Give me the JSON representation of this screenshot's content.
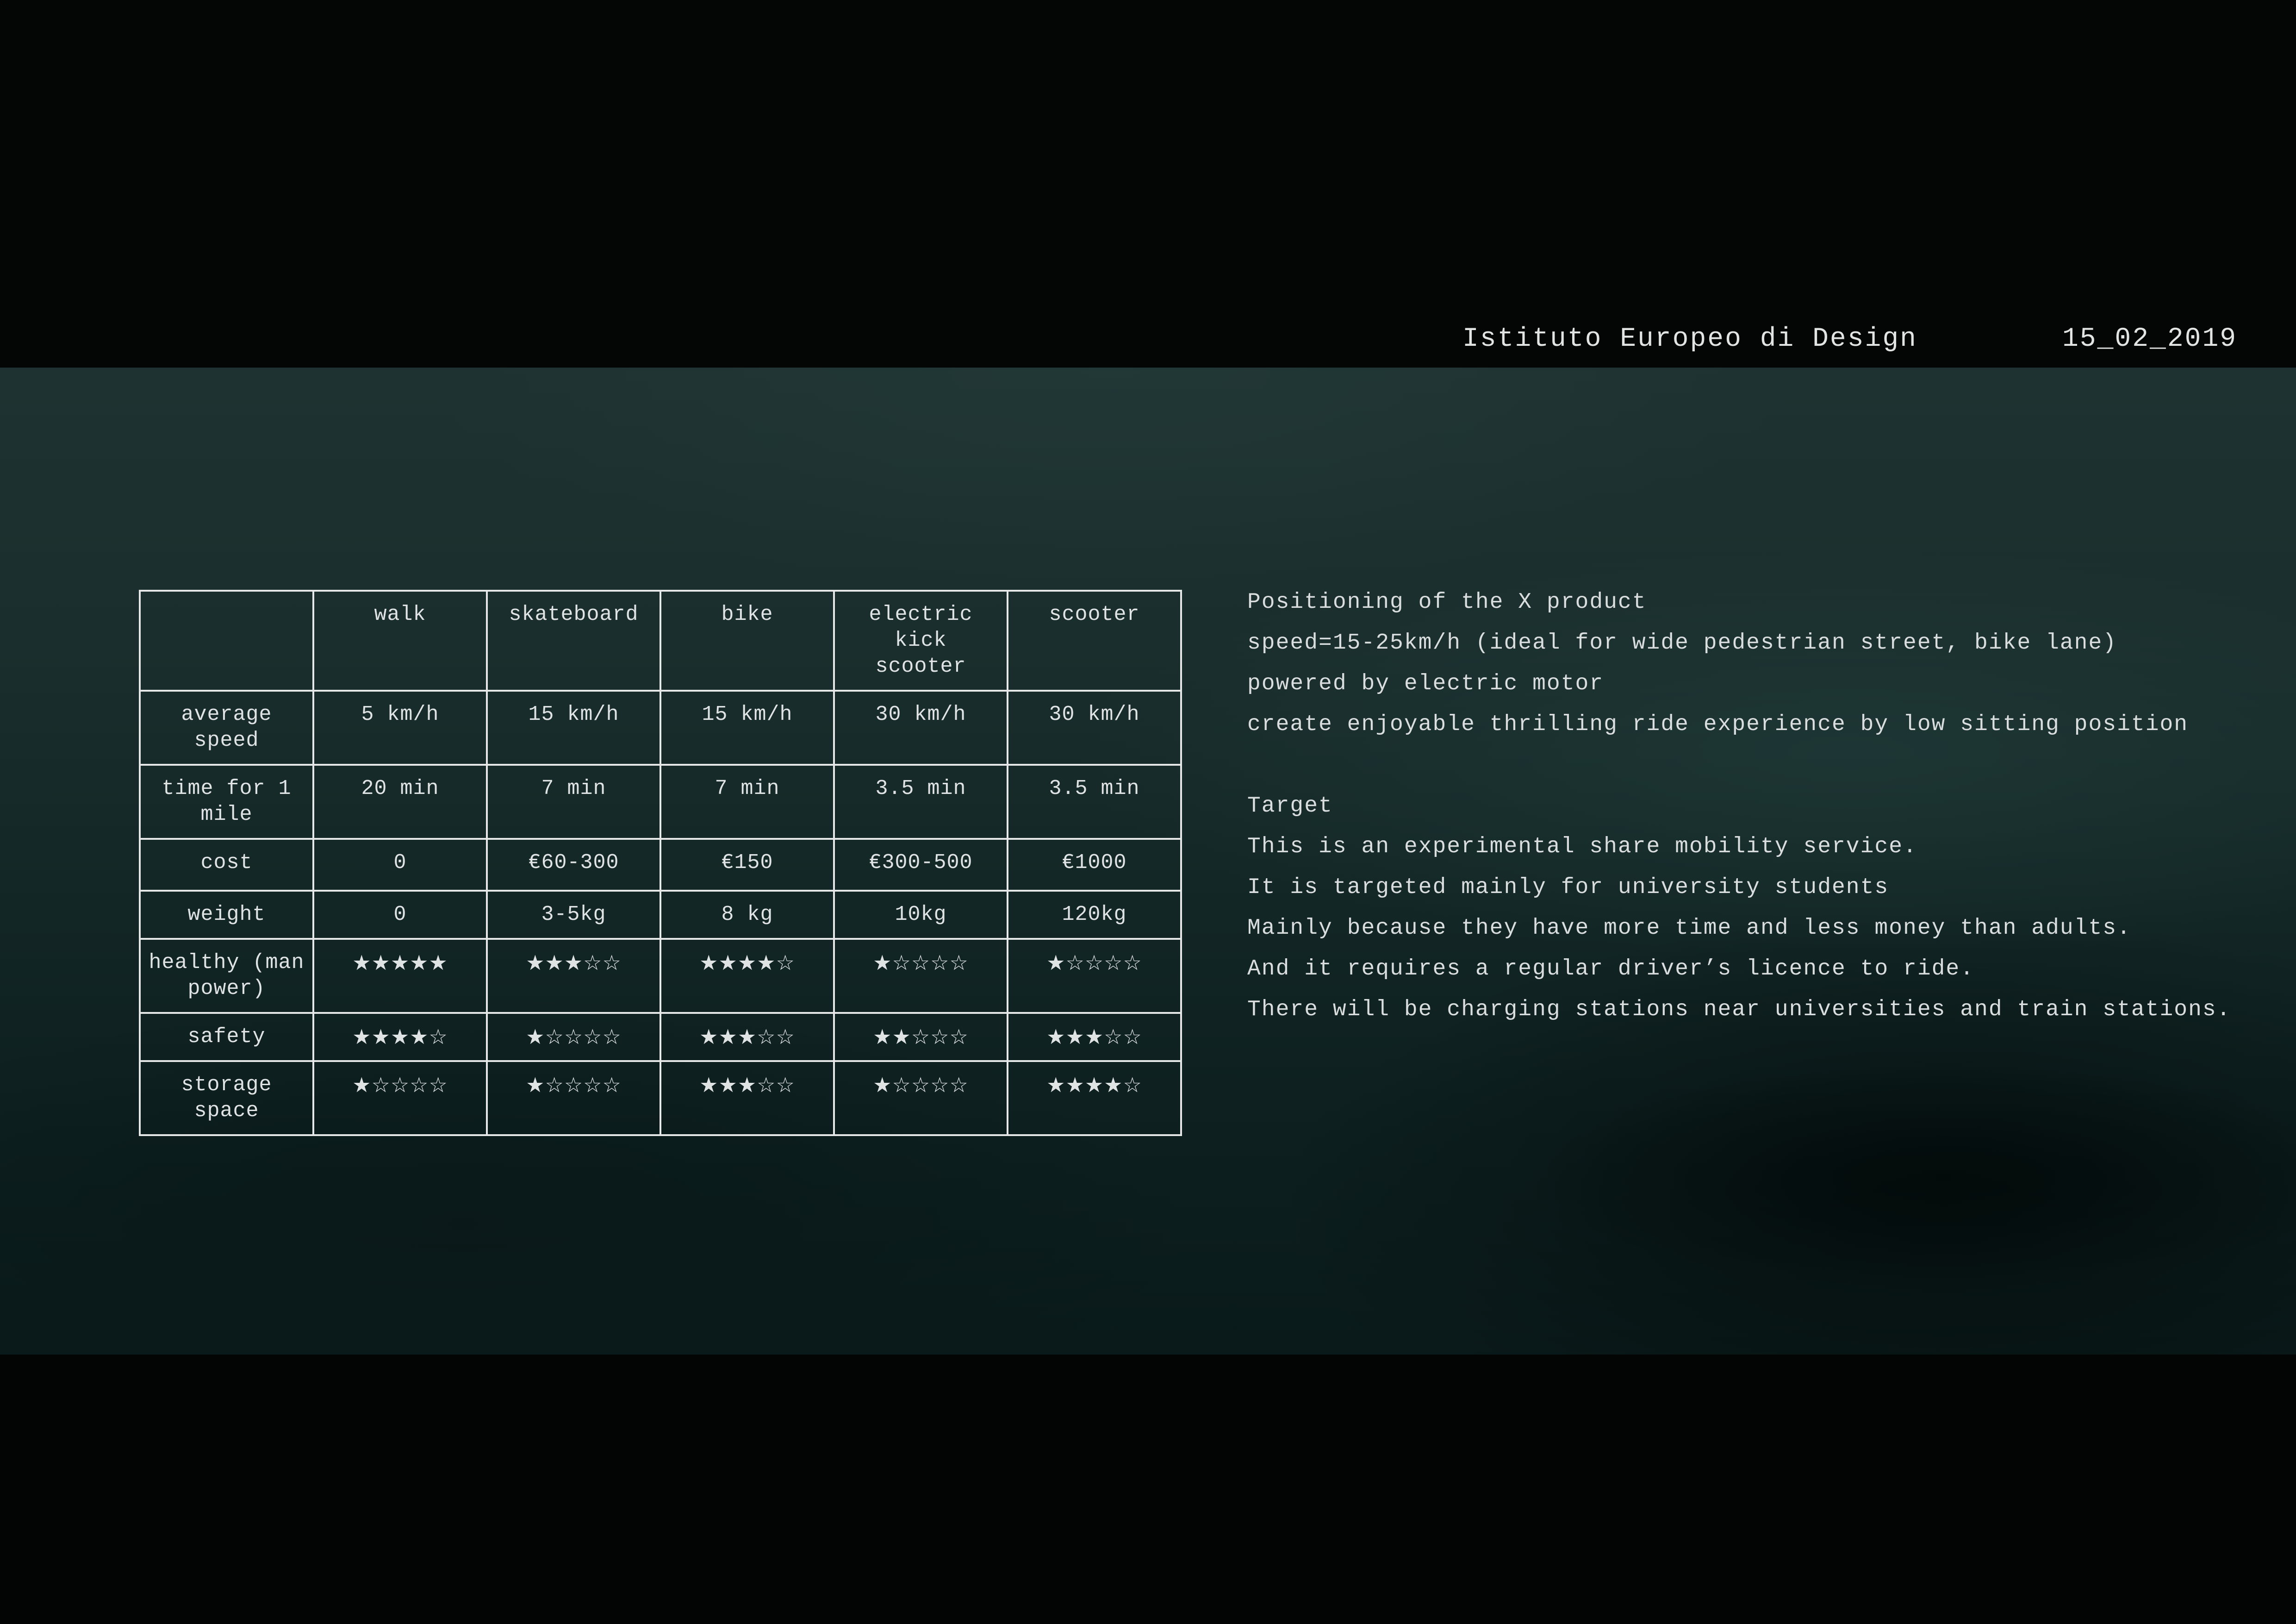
{
  "header": {
    "institute": "Istituto Europeo di Design",
    "date": "15_02_2019"
  },
  "table": {
    "columns": [
      "",
      "walk",
      "skateboard",
      "bike",
      "electric kick scooter",
      "scooter"
    ],
    "rows": [
      {
        "label": "average speed",
        "values": [
          "5 km/h",
          "15 km/h",
          "15 km/h",
          "30 km/h",
          "30 km/h"
        ]
      },
      {
        "label": "time for 1 mile",
        "values": [
          "20 min",
          "7 min",
          "7 min",
          "3.5 min",
          "3.5 min"
        ]
      },
      {
        "label": "cost",
        "values": [
          "0",
          "€60-300",
          "€150",
          "€300-500",
          "€1000"
        ]
      },
      {
        "label": "weight",
        "values": [
          "0",
          "3-5kg",
          "8 kg",
          "10kg",
          "120kg"
        ]
      },
      {
        "label": "healthy (man power)",
        "values": [
          "★★★★★",
          "★★★☆☆",
          "★★★★☆",
          "★☆☆☆☆",
          "★☆☆☆☆"
        ]
      },
      {
        "label": "safety",
        "values": [
          "★★★★☆",
          "★☆☆☆☆",
          "★★★☆☆",
          "★★☆☆☆",
          "★★★☆☆"
        ]
      },
      {
        "label": "storage space",
        "values": [
          "★☆☆☆☆",
          "★☆☆☆☆",
          "★★★☆☆",
          "★☆☆☆☆",
          "★★★★☆"
        ]
      }
    ]
  },
  "positioning": {
    "title": "Positioning of the X product",
    "lines": [
      "speed=15-25km/h (ideal for wide pedestrian street, bike lane)",
      "powered by electric motor",
      "create enjoyable thrilling ride experience by low sitting position"
    ]
  },
  "target": {
    "title": "Target",
    "lines": [
      "This is an experimental share mobility service.",
      "It is targeted mainly for university students",
      "Mainly because they have more time and less money than adults.",
      "And it requires a regular driver’s licence to ride.",
      "There will be charging stations near universities and train stations."
    ]
  }
}
